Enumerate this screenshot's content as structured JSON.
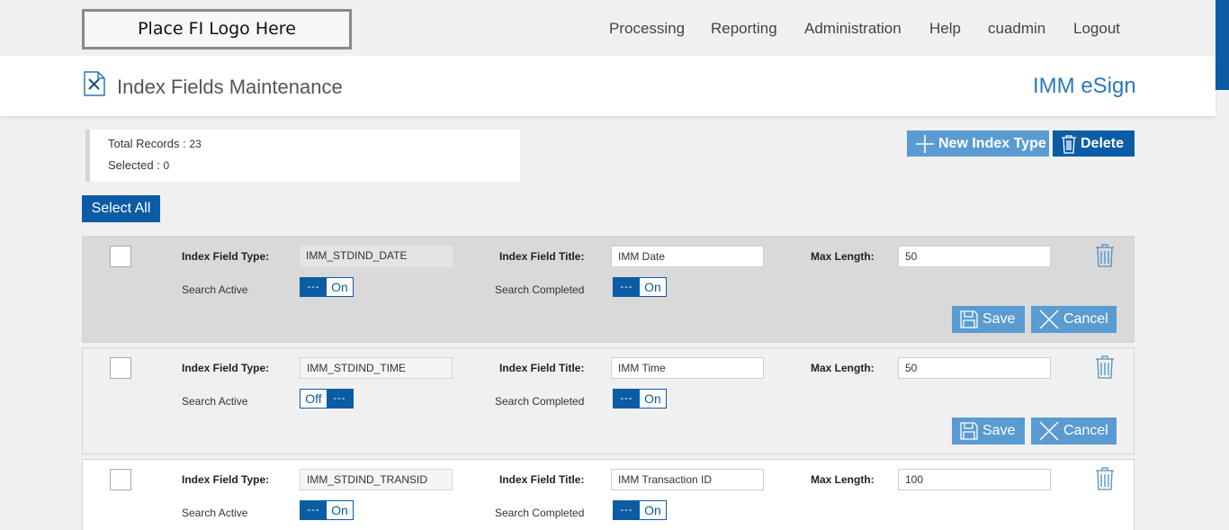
{
  "header": {
    "logo_text": "Place FI Logo Here",
    "nav": [
      "Processing",
      "Reporting",
      "Administration",
      "Help",
      "cuadmin",
      "Logout"
    ]
  },
  "page": {
    "title": "Index Fields Maintenance",
    "brand": "IMM eSign",
    "icon": "document-tools-icon"
  },
  "summary": {
    "total_label": "Total Records :",
    "total_value": "23",
    "selected_label": "Selected :",
    "selected_value": "0"
  },
  "toolbar": {
    "new_label": "New Index Type",
    "delete_label": "Delete",
    "select_all_label": "Select All"
  },
  "labels": {
    "type": "Index Field Type:",
    "title": "Index Field Title:",
    "max": "Max Length:",
    "search_active": "Search Active",
    "search_completed": "Search Completed",
    "save": "Save",
    "cancel": "Cancel",
    "toggle_dash": "---"
  },
  "rows": [
    {
      "type": "IMM_STDIND_DATE",
      "title": "IMM Date",
      "max": "50",
      "active": "On",
      "completed": "On"
    },
    {
      "type": "IMM_STDIND_TIME",
      "title": "IMM Time",
      "max": "50",
      "active": "Off",
      "completed": "On"
    },
    {
      "type": "IMM_STDIND_TRANSID",
      "title": "IMM Transaction ID",
      "max": "100",
      "active": "On",
      "completed": "On"
    }
  ],
  "colors": {
    "primary": "#0b5ca4",
    "secondary": "#5a9bd1",
    "brand_text": "#2b78b8"
  }
}
